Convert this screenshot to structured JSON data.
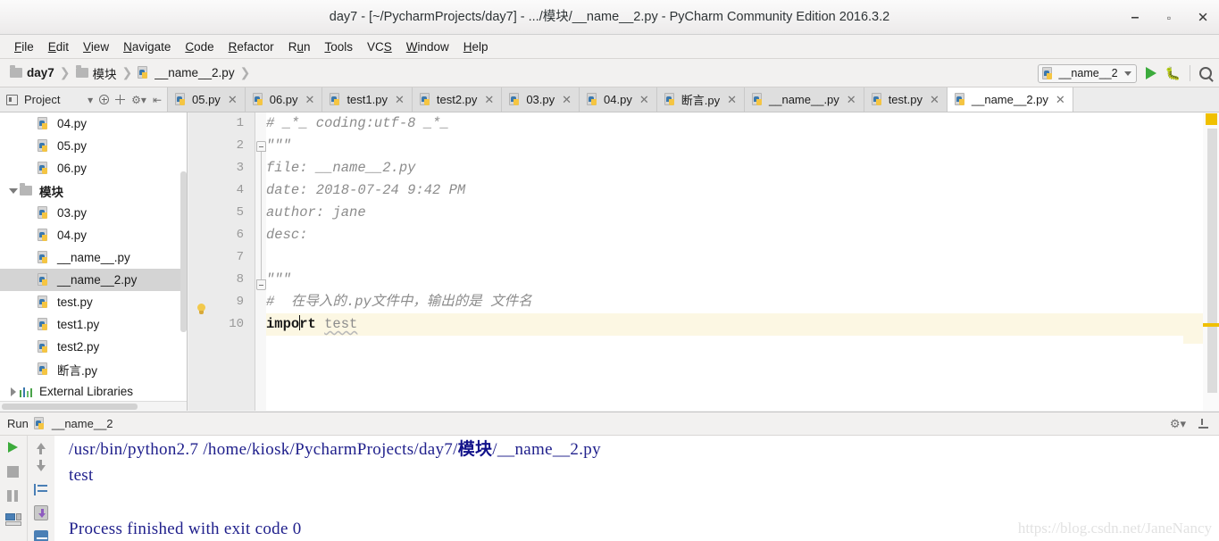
{
  "window": {
    "title": "day7 - [~/PycharmProjects/day7] - .../模块/__name__2.py - PyCharm Community Edition 2016.3.2",
    "minimize": "–",
    "maximize": "▫",
    "close": "✕"
  },
  "menubar": {
    "items": [
      {
        "label": "File",
        "mnemonic": "F"
      },
      {
        "label": "Edit",
        "mnemonic": "E"
      },
      {
        "label": "View",
        "mnemonic": "V"
      },
      {
        "label": "Navigate",
        "mnemonic": "N"
      },
      {
        "label": "Code",
        "mnemonic": "C"
      },
      {
        "label": "Refactor",
        "mnemonic": "R"
      },
      {
        "label": "Run",
        "mnemonic": "u"
      },
      {
        "label": "Tools",
        "mnemonic": "T"
      },
      {
        "label": "VCS",
        "mnemonic": "S"
      },
      {
        "label": "Window",
        "mnemonic": "W"
      },
      {
        "label": "Help",
        "mnemonic": "H"
      }
    ]
  },
  "breadcrumb": {
    "items": [
      {
        "label": "day7",
        "icon": "folder-icon",
        "bold": true
      },
      {
        "label": "模块",
        "icon": "folder-icon",
        "bold": false
      },
      {
        "label": "__name__2.py",
        "icon": "python-file-icon",
        "bold": false
      }
    ],
    "separator": "❯"
  },
  "run_config": {
    "name": "__name__2",
    "run_tooltip": "Run",
    "debug_tooltip": "Debug",
    "search_tooltip": "Search everywhere"
  },
  "tool_window": {
    "project_label": "Project",
    "icons": [
      "chevron-down-icon",
      "collapse-all-icon",
      "split-icon",
      "gear-icon",
      "hide-icon"
    ]
  },
  "tabs": [
    {
      "label": "05.py",
      "active": false
    },
    {
      "label": "06.py",
      "active": false
    },
    {
      "label": "test1.py",
      "active": false
    },
    {
      "label": "test2.py",
      "active": false
    },
    {
      "label": "03.py",
      "active": false
    },
    {
      "label": "04.py",
      "active": false
    },
    {
      "label": "断言.py",
      "active": false
    },
    {
      "label": "__name__.py",
      "active": false
    },
    {
      "label": "test.py",
      "active": false
    },
    {
      "label": "__name__2.py",
      "active": true
    }
  ],
  "tab_close": "✕",
  "project_tree": [
    {
      "label": "04.py",
      "indent": 1,
      "icon": "python-file-icon",
      "arrow": "none",
      "selected": false
    },
    {
      "label": "05.py",
      "indent": 1,
      "icon": "python-file-icon",
      "arrow": "none",
      "selected": false
    },
    {
      "label": "06.py",
      "indent": 1,
      "icon": "python-file-icon",
      "arrow": "none",
      "selected": false
    },
    {
      "label": "模块",
      "indent": 0,
      "icon": "folder-icon",
      "arrow": "down",
      "selected": false
    },
    {
      "label": "03.py",
      "indent": 1,
      "icon": "python-file-icon",
      "arrow": "none",
      "selected": false
    },
    {
      "label": "04.py",
      "indent": 1,
      "icon": "python-file-icon",
      "arrow": "none",
      "selected": false
    },
    {
      "label": "__name__.py",
      "indent": 1,
      "icon": "python-file-icon",
      "arrow": "none",
      "selected": false
    },
    {
      "label": "__name__2.py",
      "indent": 1,
      "icon": "python-file-icon",
      "arrow": "none",
      "selected": true
    },
    {
      "label": "test.py",
      "indent": 1,
      "icon": "python-file-icon",
      "arrow": "none",
      "selected": false
    },
    {
      "label": "test1.py",
      "indent": 1,
      "icon": "python-file-icon",
      "arrow": "none",
      "selected": false
    },
    {
      "label": "test2.py",
      "indent": 1,
      "icon": "python-file-icon",
      "arrow": "none",
      "selected": false
    },
    {
      "label": "断言.py",
      "indent": 1,
      "icon": "python-file-icon",
      "arrow": "none",
      "selected": false
    },
    {
      "label": "External Libraries",
      "indent": 0,
      "icon": "library-icon",
      "arrow": "right",
      "selected": false
    }
  ],
  "editor": {
    "line_numbers": [
      "1",
      "2",
      "3",
      "4",
      "5",
      "6",
      "7",
      "8",
      "9",
      "10"
    ],
    "lines": [
      {
        "n": 1,
        "segments": [
          {
            "text": "# _*_ coding:utf-8 _*_",
            "style": "comment"
          }
        ]
      },
      {
        "n": 2,
        "segments": [
          {
            "text": "\"\"\"",
            "style": "comment"
          }
        ]
      },
      {
        "n": 3,
        "segments": [
          {
            "text": "file: __name__2.py",
            "style": "comment"
          }
        ]
      },
      {
        "n": 4,
        "segments": [
          {
            "text": "date: 2018-07-24 9:42 PM",
            "style": "comment"
          }
        ]
      },
      {
        "n": 5,
        "segments": [
          {
            "text": "author: jane",
            "style": "comment"
          }
        ]
      },
      {
        "n": 6,
        "segments": [
          {
            "text": "desc:",
            "style": "comment"
          }
        ]
      },
      {
        "n": 7,
        "segments": [
          {
            "text": "",
            "style": "comment"
          }
        ]
      },
      {
        "n": 8,
        "segments": [
          {
            "text": "\"\"\"",
            "style": "comment"
          }
        ]
      },
      {
        "n": 9,
        "segments": [
          {
            "text": "#  在导入的.py文件中，输出的是 文件名",
            "style": "comment"
          }
        ]
      },
      {
        "n": 10,
        "segments": [
          {
            "text": "impo",
            "style": "keyword"
          },
          {
            "text": "|",
            "style": "caret"
          },
          {
            "text": "rt ",
            "style": "keyword"
          },
          {
            "text": "test",
            "style": "warn-identifier"
          }
        ],
        "highlight": true
      }
    ]
  },
  "run_panel": {
    "header_label": "Run",
    "config_name": "__name__2",
    "header_icons": [
      "gear-icon",
      "hide-icon"
    ],
    "side_icons": [
      "rerun-icon",
      "stop-icon",
      "pause-icon",
      "console-icon",
      "terminal-icon"
    ],
    "side_icons2": [
      "up-arrow-icon",
      "down-arrow-icon",
      "soft-wrap-icon",
      "scroll-to-end-icon",
      "print-icon"
    ],
    "console_lines": [
      {
        "parts": [
          {
            "text": "/usr/bin/python2.7 /home/kiosk/PycharmProjects/day7/",
            "cjk": false
          },
          {
            "text": "模块",
            "cjk": true
          },
          {
            "text": "/__name__2.py",
            "cjk": false
          }
        ]
      },
      {
        "parts": [
          {
            "text": "test",
            "cjk": false
          }
        ]
      },
      {
        "parts": [
          {
            "text": "",
            "cjk": false
          }
        ]
      },
      {
        "parts": [
          {
            "text": "Process finished with exit code 0",
            "cjk": false
          }
        ]
      }
    ]
  },
  "watermark": "https://blog.csdn.net/JaneNancy"
}
